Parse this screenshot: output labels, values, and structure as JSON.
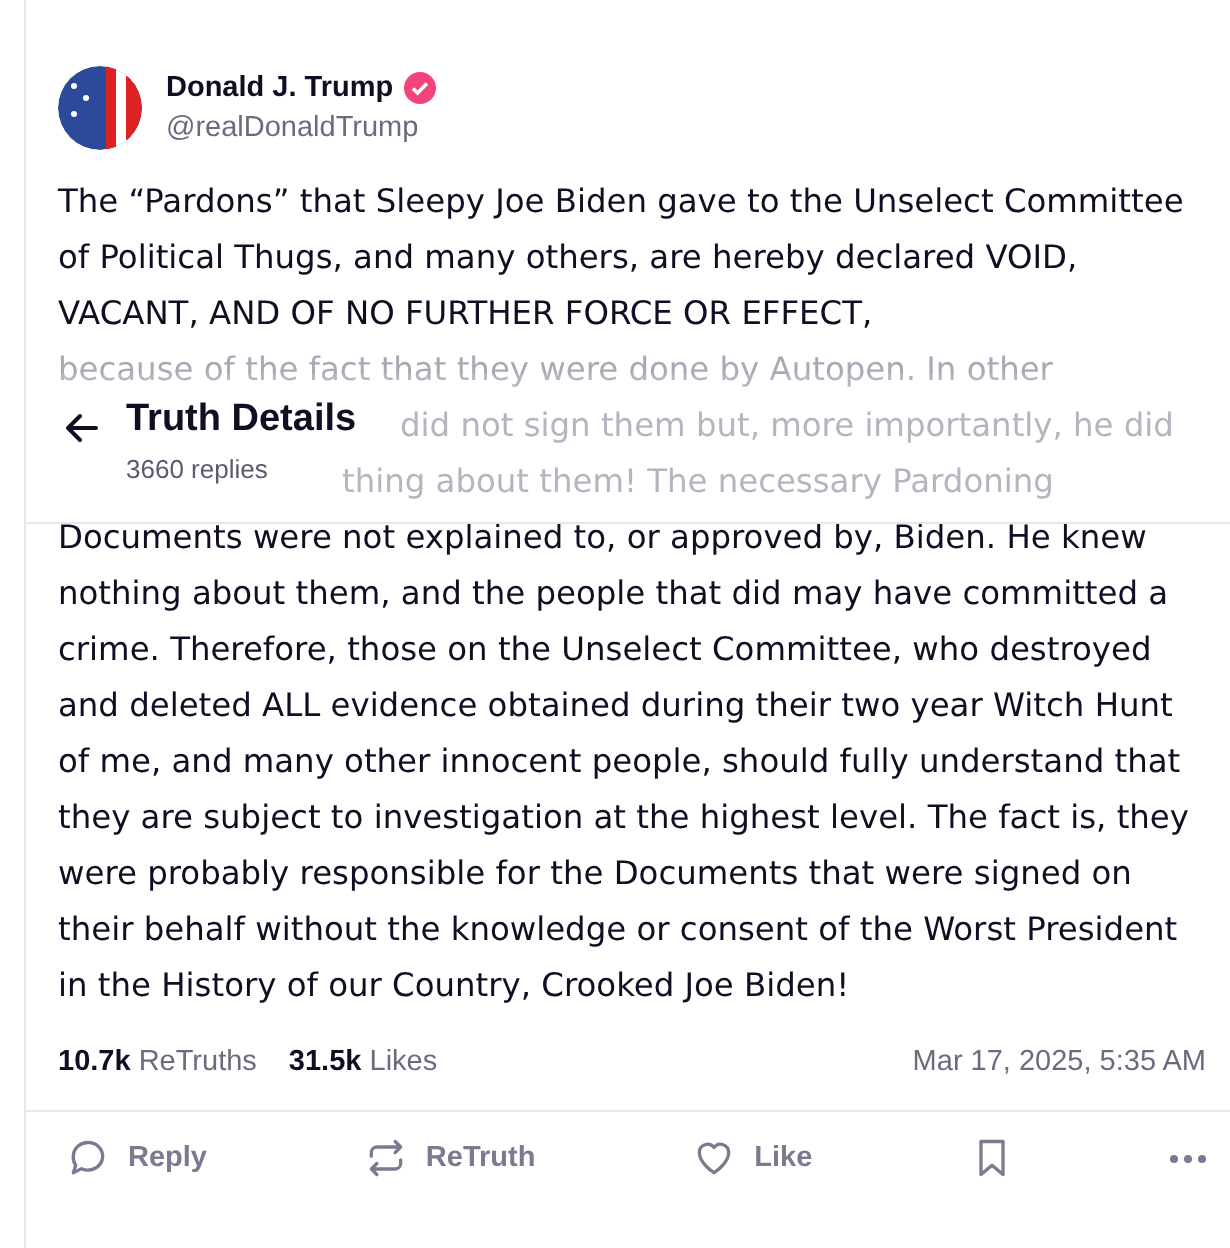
{
  "header": {
    "title": "Truth Details",
    "subtitle": "3660 replies"
  },
  "post": {
    "author": {
      "name": "Donald J. Trump",
      "verified": true,
      "handle": "@realDonaldTrump"
    },
    "text_before": "The “Pardons” that Sleepy Joe Biden gave to the Unselect Committee of Political Thugs, and many others, are hereby declared VOID, VACANT, AND OF NO FURTHER FORCE OR EFFECT,",
    "text_under_header": [
      "because of the fact that they were done by Autopen. In other",
      "did not sign them but, more importantly, he did",
      "thing about them! The necessary Pardoning"
    ],
    "text_after": "Documents were not explained to, or approved by, Biden. He knew nothing about them, and the people that did may have committed a crime. Therefore, those on the Unselect Committee, who destroyed and deleted ALL evidence obtained during their two year Witch Hunt of me, and many other innocent people, should fully understand that they are subject to investigation at the highest level. The fact is, they were probably responsible for the Documents that were signed on their behalf without the knowledge or consent of the Worst President in the History of our Country, Crooked Joe Biden!",
    "stats": [
      {
        "count": "10.7k",
        "label": "ReTruths"
      },
      {
        "count": "31.5k",
        "label": "Likes"
      }
    ],
    "timestamp": "Mar 17, 2025, 5:35 AM"
  },
  "actions": [
    {
      "kind": "reply",
      "label": "Reply"
    },
    {
      "kind": "retruth",
      "label": "ReTruth"
    },
    {
      "kind": "like",
      "label": "Like"
    },
    {
      "kind": "bookmark"
    },
    {
      "kind": "more"
    }
  ]
}
